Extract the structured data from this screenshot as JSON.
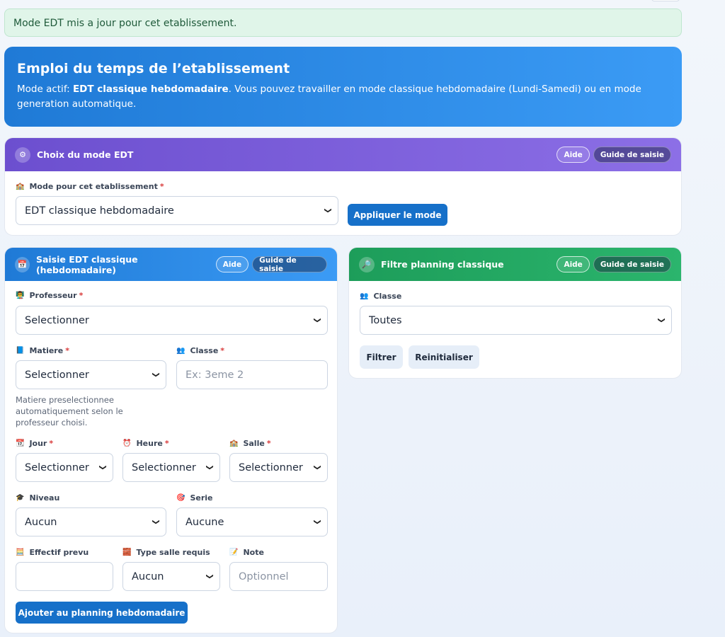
{
  "alert": {
    "text": "Mode EDT mis a jour pour cet etablissement."
  },
  "hero": {
    "title": "Emploi du temps de l’etablissement",
    "desc_prefix": "Mode actif: ",
    "desc_bold": "EDT classique hebdomadaire",
    "desc_suffix": ". Vous pouvez travailler en mode classique hebdomadaire (Lundi-Samedi) ou en mode generation automatique."
  },
  "mode_card": {
    "title": "Choix du mode EDT",
    "help": "Aide",
    "guide": "Guide de saisie",
    "field_label": "Mode pour cet etablissement",
    "required": "*",
    "selected": "EDT classique hebdomadaire",
    "apply": "Appliquer le mode"
  },
  "entry_card": {
    "title": "Saisie EDT classique (hebdomadaire)",
    "help": "Aide",
    "guide": "Guide de saisie",
    "required": "*",
    "prof_label": "Professeur",
    "prof_value": "Selectionner",
    "matiere_label": "Matiere",
    "matiere_value": "Selectionner",
    "classe_label": "Classe",
    "classe_placeholder": "Ex: 3eme 2",
    "hint": "Matiere preselectionnee automatiquement selon le professeur choisi.",
    "jour_label": "Jour",
    "jour_value": "Selectionner",
    "heure_label": "Heure",
    "heure_value": "Selectionner",
    "salle_label": "Salle",
    "salle_value": "Selectionner",
    "niveau_label": "Niveau",
    "niveau_value": "Aucun",
    "serie_label": "Serie",
    "serie_value": "Aucune",
    "effectif_label": "Effectif prevu",
    "type_salle_label": "Type salle requis",
    "type_salle_value": "Aucun",
    "note_label": "Note",
    "note_placeholder": "Optionnel",
    "submit": "Ajouter au planning hebdomadaire"
  },
  "filter_card": {
    "title": "Filtre planning classique",
    "help": "Aide",
    "guide": "Guide de saisie",
    "classe_label": "Classe",
    "classe_value": "Toutes",
    "filter": "Filtrer",
    "reset": "Reinitialiser"
  },
  "colors": {
    "primary": "#1670c9",
    "purple": "#6c4fcf",
    "green": "#1d9d5a",
    "alert_bg": "#e0f5e9"
  }
}
